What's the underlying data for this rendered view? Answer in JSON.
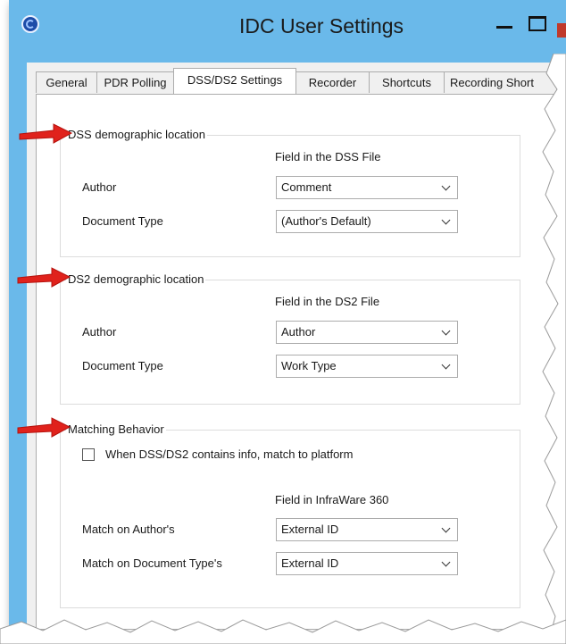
{
  "window": {
    "title": "IDC User Settings"
  },
  "tabs": [
    {
      "label": "General"
    },
    {
      "label": "PDR Polling"
    },
    {
      "label": "DSS/DS2 Settings"
    },
    {
      "label": "Recorder"
    },
    {
      "label": "Shortcuts"
    },
    {
      "label": "Recording Short"
    }
  ],
  "dss": {
    "title": "DSS demographic location",
    "column": "Field in the DSS File",
    "author_label": "Author",
    "author_value": "Comment",
    "doctype_label": "Document Type",
    "doctype_value": "(Author's Default)"
  },
  "ds2": {
    "title": "DS2 demographic location",
    "column": "Field in the DS2 File",
    "author_label": "Author",
    "author_value": "Author",
    "doctype_label": "Document Type",
    "doctype_value": "Work Type"
  },
  "matching": {
    "title": "Matching Behavior",
    "checkbox_label": "When DSS/DS2 contains info, match to platform",
    "checkbox_checked": false,
    "column": "Field in InfraWare 360",
    "author_label": "Match on Author's",
    "author_value": "External ID",
    "doctype_label": "Match on Document Type's",
    "doctype_value": "External ID"
  },
  "colors": {
    "titlebar": "#6ab9ea",
    "arrow": "#e0221c",
    "panel": "#ffffff"
  },
  "icons": [
    "app-icon",
    "minimize-icon",
    "maximize-icon",
    "chevron-down-icon",
    "red-arrow-icon"
  ]
}
